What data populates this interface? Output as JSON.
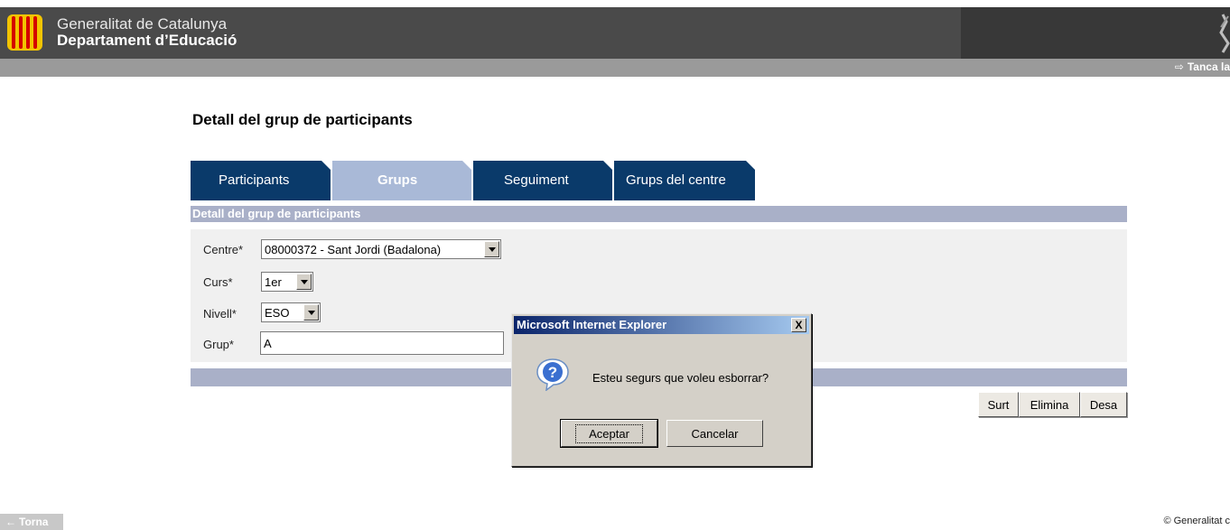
{
  "header": {
    "org_line1": "Generalitat de Catalunya",
    "org_line2": "Departament d’Educació",
    "logout_label": "Tanca la",
    "logo_icon": "catalonia-flag-icon",
    "emblem_icon": "emblem-icon"
  },
  "page": {
    "title": "Detall del grup de participants"
  },
  "tabs": [
    {
      "label": "Participants",
      "active": false
    },
    {
      "label": "Grups",
      "active": true
    },
    {
      "label": "Seguiment",
      "active": false
    },
    {
      "label": "Grups del centre",
      "active": false
    }
  ],
  "panel": {
    "header": "Detall del grup de participants"
  },
  "form": {
    "centre_label": "Centre*",
    "centre_value": "08000372 - Sant Jordi (Badalona)",
    "curs_label": "Curs*",
    "curs_value": "1er",
    "nivell_label": "Nivell*",
    "nivell_value": "ESO",
    "grup_label": "Grup*",
    "grup_value": "A"
  },
  "actions": {
    "surt": "Surt",
    "elimina": "Elimina",
    "desa": "Desa"
  },
  "dialog": {
    "title": "Microsoft Internet Explorer",
    "close_label": "X",
    "message": "Esteu segurs que voleu esborrar?",
    "ok_label": "Aceptar",
    "cancel_label": "Cancelar",
    "icon": "question-icon"
  },
  "footer": {
    "back_label": "Torna",
    "copyright": "© Generalitat c"
  },
  "colors": {
    "tab_dark": "#0a3a6a",
    "tab_active": "#a9b9d7",
    "panel_bar": "#a9b0c8",
    "dialog_title": "#0a246a"
  }
}
